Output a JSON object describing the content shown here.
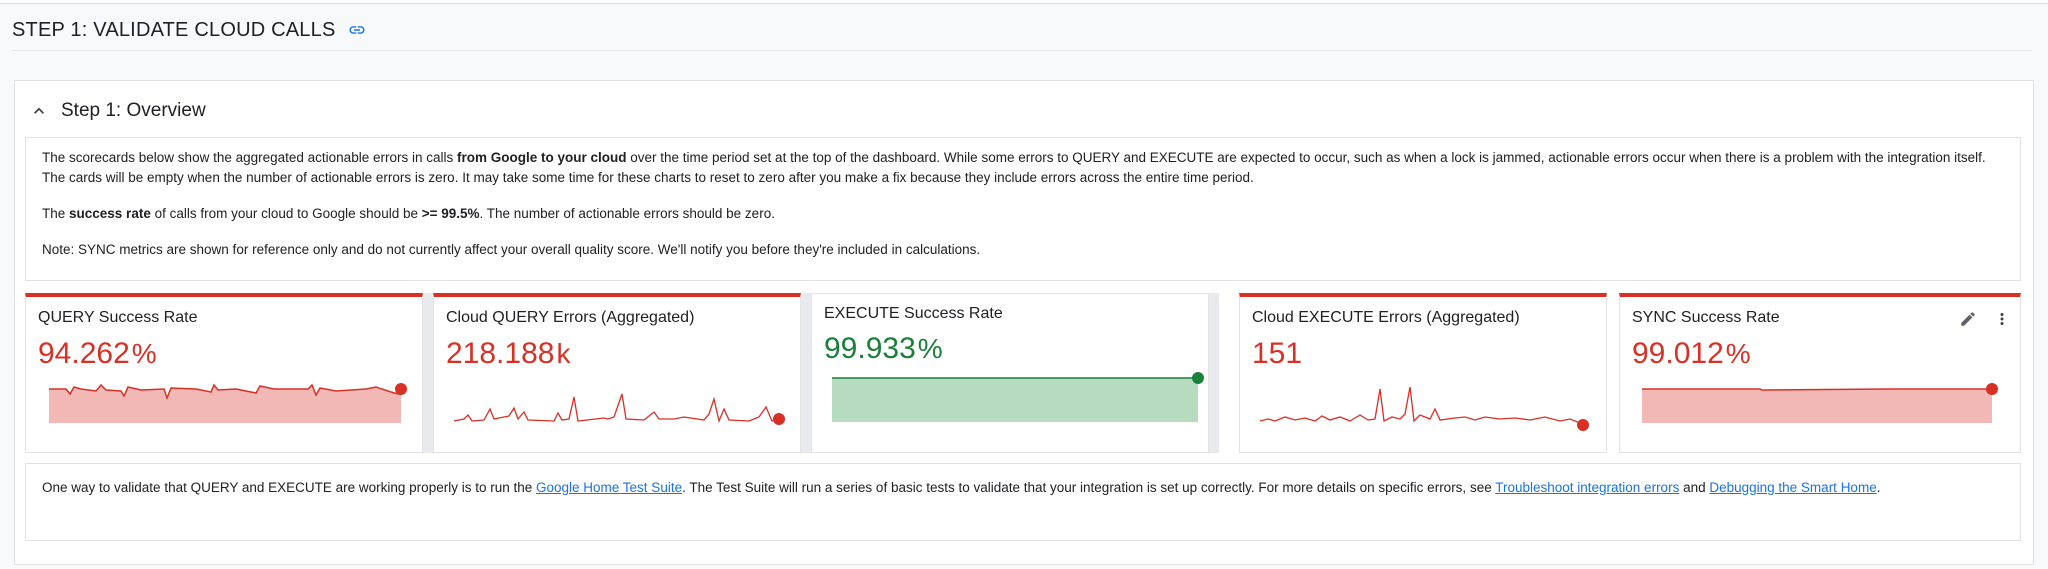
{
  "section": {
    "title": "STEP 1: VALIDATE CLOUD CALLS"
  },
  "panel": {
    "title": "Step 1: Overview"
  },
  "description": {
    "p1_a": "The scorecards below show the aggregated actionable errors in calls ",
    "p1_bold": "from Google to your cloud",
    "p1_b": " over the time period set at the top of the dashboard. While some errors to QUERY and EXECUTE are expected to occur, such as when a lock is jammed, actionable errors occur when there is a problem with the integration itself. The cards will be empty when the number of actionable errors is zero. It may take some time for these charts to reset to zero after you make a fix because they include errors across the entire time period.",
    "p2_a": "The ",
    "p2_bold1": "success rate",
    "p2_b": " of calls from your cloud to Google should be ",
    "p2_bold2": ">= 99.5%",
    "p2_c": ". The number of actionable errors should be zero.",
    "p3": "Note: SYNC metrics are shown for reference only and do not currently affect your overall quality score. We'll notify you before they're included in calculations."
  },
  "cards": [
    {
      "title": "QUERY Success Rate",
      "value": "94.262",
      "unit": "%",
      "color": "#d93025"
    },
    {
      "title": "Cloud QUERY Errors (Aggregated)",
      "value": "218.188",
      "unit": "k",
      "color": "#d93025"
    },
    {
      "title": "EXECUTE Success Rate",
      "value": "99.933",
      "unit": "%",
      "color": "#188038"
    },
    {
      "title": "Cloud EXECUTE Errors (Aggregated)",
      "value": "151",
      "unit": "",
      "color": "#d93025"
    },
    {
      "title": "SYNC Success Rate",
      "value": "99.012",
      "unit": "%",
      "color": "#d93025"
    }
  ],
  "footer": {
    "a": "One way to validate that QUERY and EXECUTE are working properly is to run the ",
    "link1": "Google Home Test Suite",
    "b": ". The Test Suite will run a series of basic tests to validate that your integration is set up correctly. For more details on specific errors, see ",
    "link2": "Troubleshoot integration errors",
    "c": " and ",
    "link3": "Debugging the Smart Home",
    "d": "."
  },
  "icons": {
    "link": "link-icon",
    "collapse": "chevron-up-icon",
    "edit": "pencil-icon",
    "more": "more-vert-icon"
  }
}
